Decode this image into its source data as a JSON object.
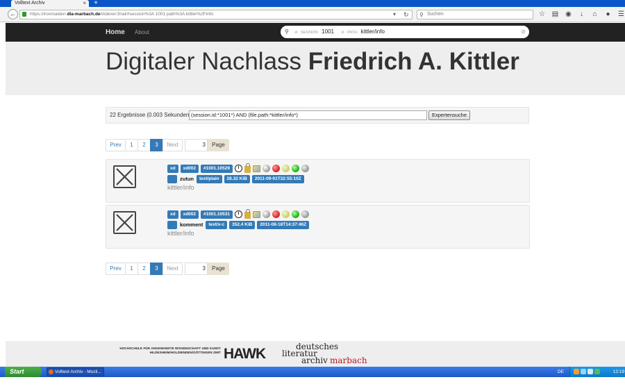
{
  "browser": {
    "tab_title": "Volltext Archiv",
    "tab_close": "×",
    "new_tab": "+",
    "url_prefix": "https://ironmaiden.",
    "url_domain": "dla-marbach.de",
    "url_suffix": "/indexer.final/#session%3A 1001 path%3A kittler%2Finfo",
    "search_placeholder": "Suchen"
  },
  "site_nav": {
    "home_label": "Home",
    "about_label": "About",
    "search": {
      "session_key": "SESSION:",
      "session_value": "1001",
      "path_key": "PATH:",
      "path_value": "kittler/info"
    }
  },
  "header": {
    "title_light": "Digitaler Nachlass ",
    "title_bold": "Friedrich A. Kittler"
  },
  "query": {
    "result_count": "22 Ergebnisse (0.003 Sekunden)",
    "expression": "(session.id:*1001*) AND (file.path:*kittler/info*)",
    "expert_button": "Expertensuche"
  },
  "pagination": {
    "prev": "Prev",
    "pages": [
      "1",
      "2",
      "3"
    ],
    "active_page": "3",
    "next": "Next",
    "page_input": "3",
    "page_button": "Page"
  },
  "results": [
    {
      "tag_fs": "xd",
      "tag_disk": "xd002",
      "tag_id": "#1001.10529",
      "filename": "zutun",
      "mime": "text/plain",
      "size": "28.32 KiB",
      "date": "2011-09-01T22:55:10Z",
      "path": "kittler/info"
    },
    {
      "tag_fs": "xd",
      "tag_disk": "xd002",
      "tag_id": "#1001.10531",
      "filename": "komment",
      "mime": "text/x-c",
      "size": "352.4 KiB",
      "date": "2011-08-18T14:37:46Z",
      "path": "kittler/info"
    }
  ],
  "footer": {
    "hawk_text": "HOCHSCHULE FÜR ANGEWANDTE WISSENSCHAFT UND KUNST HILDESHEIM/HOLZMINDEN/GÖTTINGEN ZIMT",
    "hawk_logo": "HAWK",
    "dla_line1": "deutsches",
    "dla_line2": "literatur",
    "dla_line3": "archiv",
    "dla_marbach": "marbach"
  },
  "taskbar": {
    "start_label": "Start",
    "task_label": "Volltext Archiv - Mozil...",
    "language": "DE",
    "clock": "12:19"
  }
}
